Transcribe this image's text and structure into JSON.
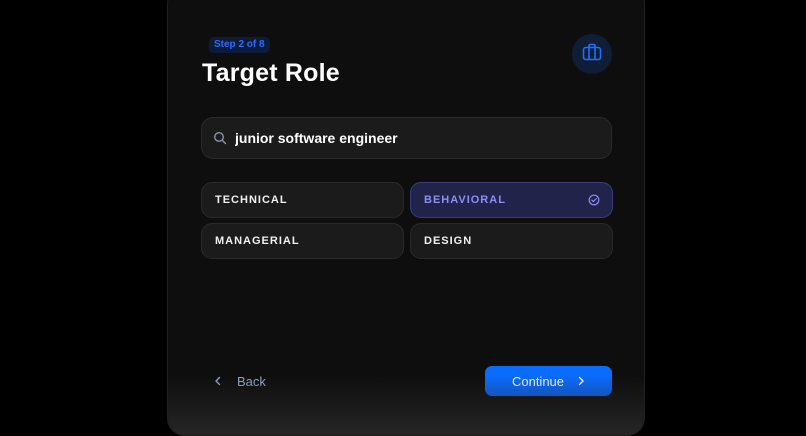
{
  "header": {
    "step": "Step 2 of 8",
    "title": "Target Role",
    "icon": "briefcase-icon"
  },
  "search": {
    "value": "junior software engineer",
    "placeholder": "",
    "icon": "search-icon"
  },
  "categories": [
    {
      "label": "TECHNICAL",
      "selected": false
    },
    {
      "label": "BEHAVIORAL",
      "selected": true
    },
    {
      "label": "MANAGERIAL",
      "selected": false
    },
    {
      "label": "DESIGN",
      "selected": false
    }
  ],
  "footer": {
    "back_label": "Back",
    "continue_label": "Continue"
  },
  "colors": {
    "accent": "#0a6cff",
    "selected_bg": "#22234a",
    "selected_text": "#8b8ff5",
    "background": "#0e0e0e"
  }
}
